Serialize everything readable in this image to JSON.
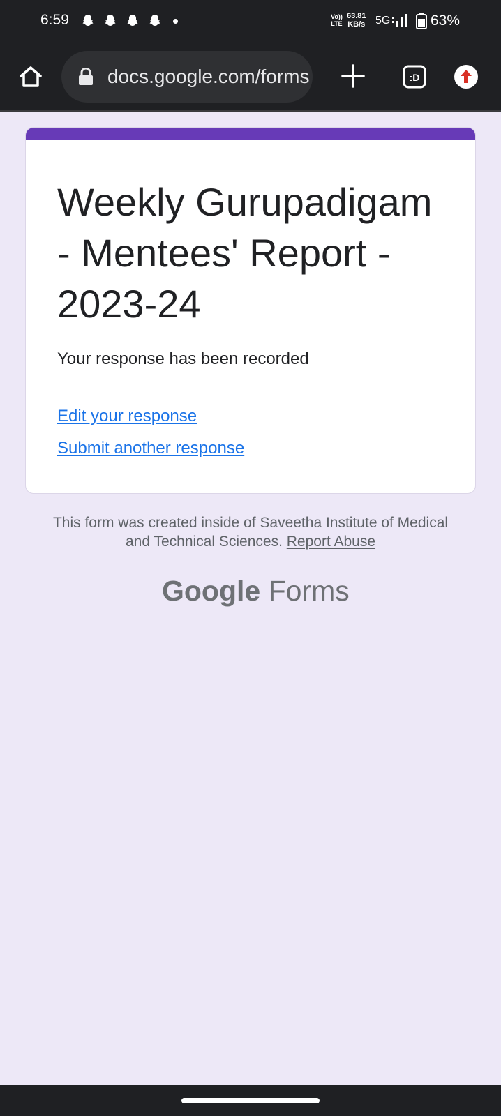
{
  "status_bar": {
    "time": "6:59",
    "volte_line1": "Vo))",
    "volte_line2": "LTE",
    "net_speed_value": "63.81",
    "net_speed_unit": "KB/s",
    "network": "5G",
    "battery_percent": "63%",
    "notification_icons": [
      "snapchat-icon",
      "snapchat-icon",
      "snapchat-icon",
      "snapchat-icon"
    ]
  },
  "browser": {
    "url": "docs.google.com/forms",
    "icons": [
      "home-icon",
      "lock-icon",
      "plus-icon",
      "tab-switcher-icon",
      "update-icon"
    ],
    "tab_switcher_label": ":D"
  },
  "form": {
    "accent_color": "#673ab7",
    "title": "Weekly Gurupadigam - Mentees' Report - 2023-24",
    "confirmation": "Your response has been recorded",
    "edit_link": "Edit your response",
    "another_link": "Submit another response"
  },
  "footer": {
    "note": "This form was created inside of Saveetha Institute of Medical and Technical Sciences.",
    "report_abuse": "Report Abuse",
    "brand_google": "Google",
    "brand_forms": "Forms"
  }
}
